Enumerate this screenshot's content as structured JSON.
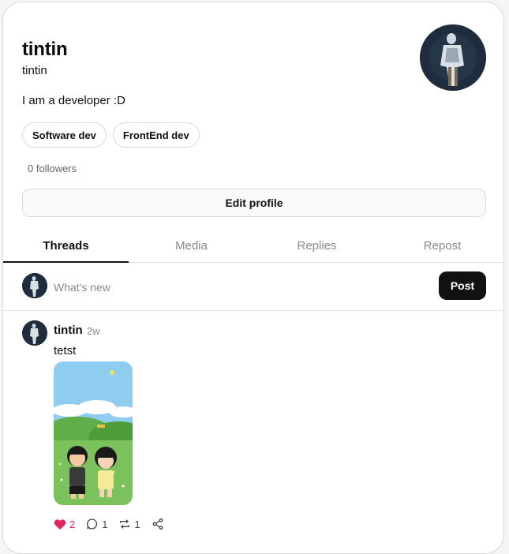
{
  "profile": {
    "name": "tintin",
    "handle": "tintin",
    "bio": "I am a developer :D",
    "tags": [
      "Software dev",
      "FrontEnd dev"
    ],
    "followers": "0 followers",
    "edit_label": "Edit profile"
  },
  "tabs": [
    {
      "label": "Threads",
      "active": true
    },
    {
      "label": "Media",
      "active": false
    },
    {
      "label": "Replies",
      "active": false
    },
    {
      "label": "Repost",
      "active": false
    }
  ],
  "composer": {
    "placeholder": "What's new",
    "post_label": "Post"
  },
  "thread": {
    "author": "tintin",
    "time": "2w",
    "text": "tetst",
    "likes": "2",
    "comments": "1",
    "reposts": "1"
  },
  "colors": {
    "like": "#e0245e",
    "post_button": "#111111"
  },
  "icons": [
    "heart-icon",
    "comment-icon",
    "repost-icon",
    "share-icon"
  ]
}
